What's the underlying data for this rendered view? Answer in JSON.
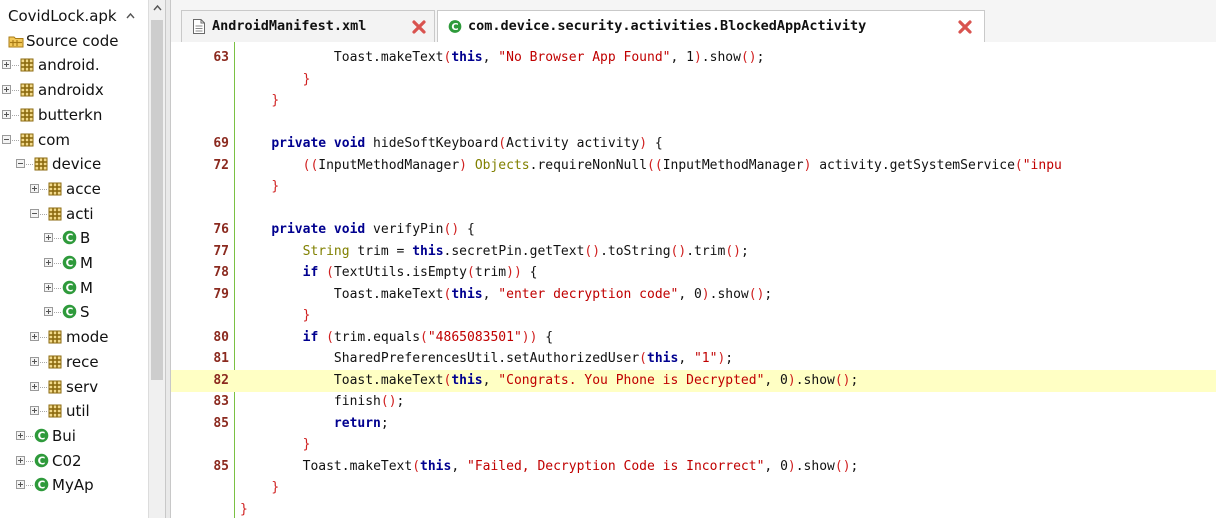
{
  "project_tree": {
    "items": [
      {
        "label": "CovidLock.apk",
        "kind": "file",
        "expander": "",
        "indent": 0,
        "partial": true
      },
      {
        "label": "Source code",
        "kind": "source",
        "expander": "",
        "indent": 0
      },
      {
        "label": "android.",
        "kind": "package",
        "expander": "plus",
        "indent": 1
      },
      {
        "label": "androidx",
        "kind": "package",
        "expander": "plus",
        "indent": 1
      },
      {
        "label": "butterkn",
        "kind": "package",
        "expander": "plus",
        "indent": 1
      },
      {
        "label": "com",
        "kind": "package",
        "expander": "minus",
        "indent": 1
      },
      {
        "label": "device",
        "kind": "package",
        "expander": "minus",
        "indent": 2
      },
      {
        "label": "acce",
        "kind": "package",
        "expander": "plus",
        "indent": 3
      },
      {
        "label": "acti",
        "kind": "package",
        "expander": "minus",
        "indent": 3
      },
      {
        "label": "B",
        "kind": "class",
        "expander": "plus",
        "indent": 4
      },
      {
        "label": "M",
        "kind": "class",
        "expander": "plus",
        "indent": 4
      },
      {
        "label": "M",
        "kind": "class",
        "expander": "plus",
        "indent": 4
      },
      {
        "label": "S",
        "kind": "class",
        "expander": "plus",
        "indent": 4
      },
      {
        "label": "mode",
        "kind": "package",
        "expander": "plus",
        "indent": 3
      },
      {
        "label": "rece",
        "kind": "package",
        "expander": "plus",
        "indent": 3
      },
      {
        "label": "serv",
        "kind": "package",
        "expander": "plus",
        "indent": 3
      },
      {
        "label": "util",
        "kind": "package",
        "expander": "plus",
        "indent": 3
      },
      {
        "label": "Bui",
        "kind": "class",
        "expander": "plus",
        "indent": 2
      },
      {
        "label": "C02",
        "kind": "class",
        "expander": "plus",
        "indent": 2
      },
      {
        "label": "MyAp",
        "kind": "class",
        "expander": "plus",
        "indent": 2
      }
    ]
  },
  "tabs": [
    {
      "label": "AndroidManifest.xml",
      "icon": "file-icon",
      "active": false
    },
    {
      "label": "com.device.security.activities.BlockedAppActivity",
      "icon": "class-icon",
      "active": true
    }
  ],
  "editor": {
    "highlight_line_index": 15,
    "lines": [
      {
        "num": "63",
        "tokens": [
          [
            "",
            "            "
          ],
          [
            "",
            "Toast.makeText"
          ],
          [
            "par",
            "("
          ],
          [
            "kw",
            "this"
          ],
          [
            "",
            ", "
          ],
          [
            "str",
            "\"No Browser App Found\""
          ],
          [
            "",
            ", 1"
          ],
          [
            "par",
            ")"
          ],
          [
            "",
            ".show"
          ],
          [
            "par",
            "()"
          ],
          [
            "",
            ";"
          ]
        ]
      },
      {
        "num": "",
        "tokens": [
          [
            "",
            "        "
          ],
          [
            "par",
            "}"
          ]
        ]
      },
      {
        "num": "",
        "tokens": [
          [
            "",
            "    "
          ],
          [
            "par",
            "}"
          ]
        ]
      },
      {
        "num": "",
        "tokens": []
      },
      {
        "num": "69",
        "tokens": [
          [
            "",
            "    "
          ],
          [
            "kw",
            "private void"
          ],
          [
            "",
            " hideSoftKeyboard"
          ],
          [
            "par",
            "("
          ],
          [
            "",
            "Activity activity"
          ],
          [
            "par",
            ")"
          ],
          [
            "",
            " {"
          ]
        ]
      },
      {
        "num": "72",
        "tokens": [
          [
            "",
            "        "
          ],
          [
            "par",
            "(("
          ],
          [
            "",
            "InputMethodManager"
          ],
          [
            "par",
            ")"
          ],
          [
            "",
            " "
          ],
          [
            "ann",
            "Objects"
          ],
          [
            "",
            ".requireNonNull"
          ],
          [
            "par",
            "(("
          ],
          [
            "",
            "InputMethodManager"
          ],
          [
            "par",
            ")"
          ],
          [
            "",
            " activity.getSystemService"
          ],
          [
            "par",
            "("
          ],
          [
            "str",
            "\"inpu"
          ]
        ]
      },
      {
        "num": "",
        "tokens": [
          [
            "",
            "    "
          ],
          [
            "par",
            "}"
          ]
        ]
      },
      {
        "num": "",
        "tokens": []
      },
      {
        "num": "76",
        "tokens": [
          [
            "",
            "    "
          ],
          [
            "kw",
            "private void"
          ],
          [
            "",
            " verifyPin"
          ],
          [
            "par",
            "()"
          ],
          [
            "",
            " {"
          ]
        ]
      },
      {
        "num": "77",
        "tokens": [
          [
            "",
            "        "
          ],
          [
            "ann",
            "String"
          ],
          [
            "",
            " trim = "
          ],
          [
            "kw",
            "this"
          ],
          [
            "",
            ".secretPin.getText"
          ],
          [
            "par",
            "()"
          ],
          [
            "",
            ".toString"
          ],
          [
            "par",
            "()"
          ],
          [
            "",
            ".trim"
          ],
          [
            "par",
            "()"
          ],
          [
            "",
            ";"
          ]
        ]
      },
      {
        "num": "78",
        "tokens": [
          [
            "",
            "        "
          ],
          [
            "kw",
            "if"
          ],
          [
            "",
            " "
          ],
          [
            "par",
            "("
          ],
          [
            "",
            "TextUtils.isEmpty"
          ],
          [
            "par",
            "("
          ],
          [
            "",
            "trim"
          ],
          [
            "par",
            "))"
          ],
          [
            "",
            " {"
          ]
        ]
      },
      {
        "num": "79",
        "tokens": [
          [
            "",
            "            "
          ],
          [
            "",
            "Toast.makeText"
          ],
          [
            "par",
            "("
          ],
          [
            "kw",
            "this"
          ],
          [
            "",
            ", "
          ],
          [
            "str",
            "\"enter decryption code\""
          ],
          [
            "",
            ", 0"
          ],
          [
            "par",
            ")"
          ],
          [
            "",
            ".show"
          ],
          [
            "par",
            "()"
          ],
          [
            "",
            ";"
          ]
        ]
      },
      {
        "num": "",
        "tokens": [
          [
            "",
            "        "
          ],
          [
            "par",
            "}"
          ]
        ]
      },
      {
        "num": "80",
        "tokens": [
          [
            "",
            "        "
          ],
          [
            "kw",
            "if"
          ],
          [
            "",
            " "
          ],
          [
            "par",
            "("
          ],
          [
            "",
            "trim.equals"
          ],
          [
            "par",
            "("
          ],
          [
            "str",
            "\"4865083501\""
          ],
          [
            "par",
            "))"
          ],
          [
            "",
            " {"
          ]
        ]
      },
      {
        "num": "81",
        "tokens": [
          [
            "",
            "            "
          ],
          [
            "",
            "SharedPreferencesUtil.setAuthorizedUser"
          ],
          [
            "par",
            "("
          ],
          [
            "kw",
            "this"
          ],
          [
            "",
            ", "
          ],
          [
            "str",
            "\"1\""
          ],
          [
            "par",
            ")"
          ],
          [
            "",
            ";"
          ]
        ]
      },
      {
        "num": "82",
        "tokens": [
          [
            "",
            "            "
          ],
          [
            "",
            "Toast.makeText"
          ],
          [
            "par",
            "("
          ],
          [
            "kw",
            "this"
          ],
          [
            "",
            ", "
          ],
          [
            "str",
            "\"Congrats. You Phone is Decrypted\""
          ],
          [
            "",
            ", 0"
          ],
          [
            "par",
            ")"
          ],
          [
            "",
            ".show"
          ],
          [
            "par",
            "()"
          ],
          [
            "",
            ";"
          ]
        ]
      },
      {
        "num": "83",
        "tokens": [
          [
            "",
            "            "
          ],
          [
            "",
            "finish"
          ],
          [
            "par",
            "()"
          ],
          [
            "",
            ";"
          ]
        ]
      },
      {
        "num": "85",
        "tokens": [
          [
            "",
            "            "
          ],
          [
            "kw",
            "return"
          ],
          [
            "",
            ";"
          ]
        ]
      },
      {
        "num": "",
        "tokens": [
          [
            "",
            "        "
          ],
          [
            "par",
            "}"
          ]
        ]
      },
      {
        "num": "85",
        "tokens": [
          [
            "",
            "        "
          ],
          [
            "",
            "Toast.makeText"
          ],
          [
            "par",
            "("
          ],
          [
            "kw",
            "this"
          ],
          [
            "",
            ", "
          ],
          [
            "str",
            "\"Failed, Decryption Code is Incorrect\""
          ],
          [
            "",
            ", 0"
          ],
          [
            "par",
            ")"
          ],
          [
            "",
            ".show"
          ],
          [
            "par",
            "()"
          ],
          [
            "",
            ";"
          ]
        ]
      },
      {
        "num": "",
        "tokens": [
          [
            "",
            "    "
          ],
          [
            "par",
            "}"
          ]
        ]
      },
      {
        "num": "",
        "tokens": [
          [
            "par",
            "}"
          ]
        ]
      }
    ]
  },
  "colors": {
    "package_icon": "#8b6a10",
    "class_icon": "#2e9a3b",
    "close_icon": "#d9534f",
    "highlight": "#ffffc4",
    "gutter_bar": "#7ac143"
  }
}
